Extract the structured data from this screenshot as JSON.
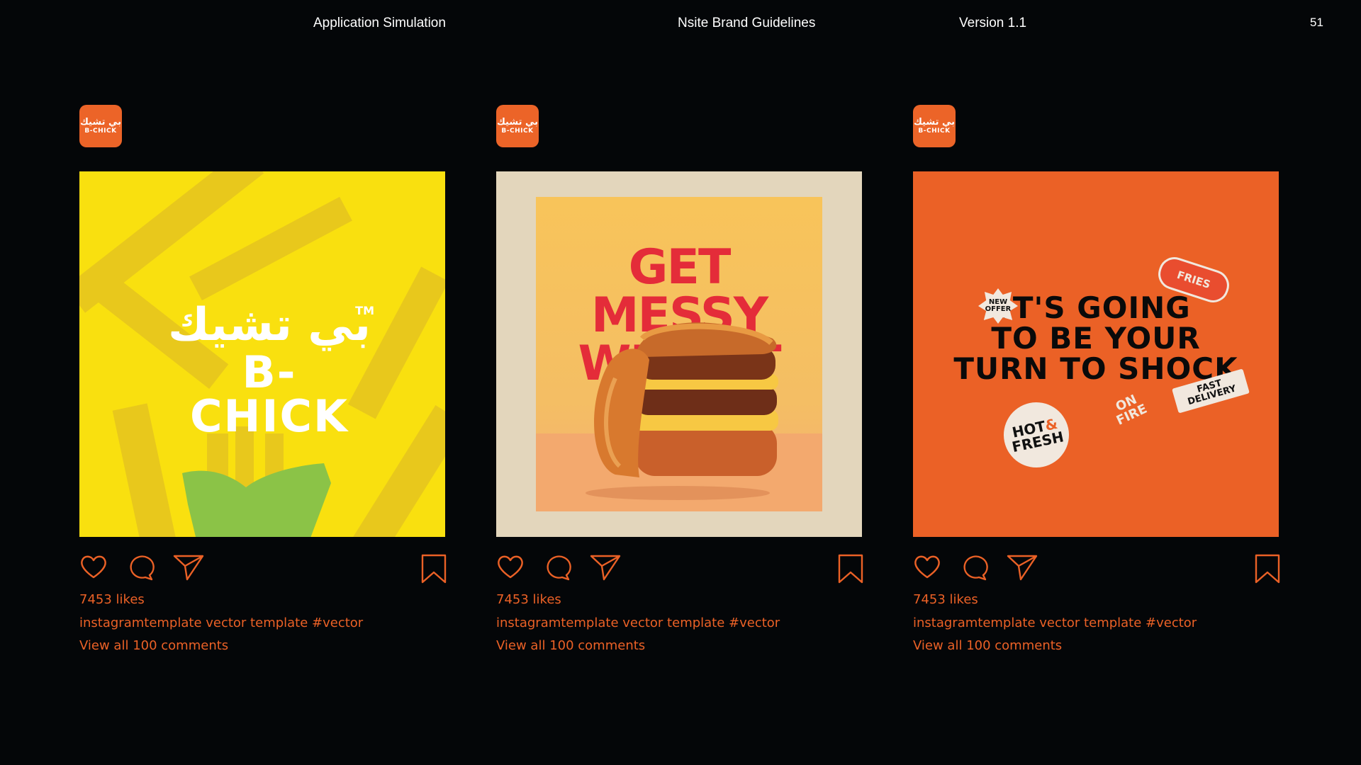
{
  "header": {
    "section": "Application Simulation",
    "doc_title": "Nsite Brand Guidelines",
    "version": "Version 1.1",
    "page_number": "51"
  },
  "brand": {
    "accent": "#EB6126",
    "background": "#040608",
    "avatar_arabic": "بي تشيك",
    "avatar_latin": "B-CHICK"
  },
  "posts": [
    {
      "artwork": {
        "logo_arabic": "بي تشيك",
        "logo_latin": "B-CHICK",
        "trademark": "TM"
      },
      "likes": "7453 likes",
      "caption": "instagramtemplate vector template #vector",
      "comments": "View all 100 comments"
    },
    {
      "artwork": {
        "line1": "GET",
        "line2": "MESSY",
        "line3": "WITH IT"
      },
      "likes": "7453 likes",
      "caption": "instagramtemplate vector template #vector",
      "comments": "View all 100 comments"
    },
    {
      "artwork": {
        "line1": "IT'S GOING",
        "line2": "TO BE YOUR",
        "line3": "TURN TO  SHOCK",
        "sticker_new_1": "NEW",
        "sticker_new_2": "OFFER",
        "sticker_fries": "FRIES",
        "sticker_hot_1": "HOT",
        "sticker_hot_amp": "&",
        "sticker_hot_2": "FRESH",
        "sticker_fire_1": "ON",
        "sticker_fire_2": "FIRE",
        "sticker_fast_1": "FAST",
        "sticker_fast_2": "DELIVERY"
      },
      "likes": "7453 likes",
      "caption": "instagramtemplate vector template #vector",
      "comments": "View all 100 comments"
    }
  ],
  "icons": [
    "heart-icon",
    "comment-icon",
    "send-icon",
    "bookmark-icon"
  ]
}
